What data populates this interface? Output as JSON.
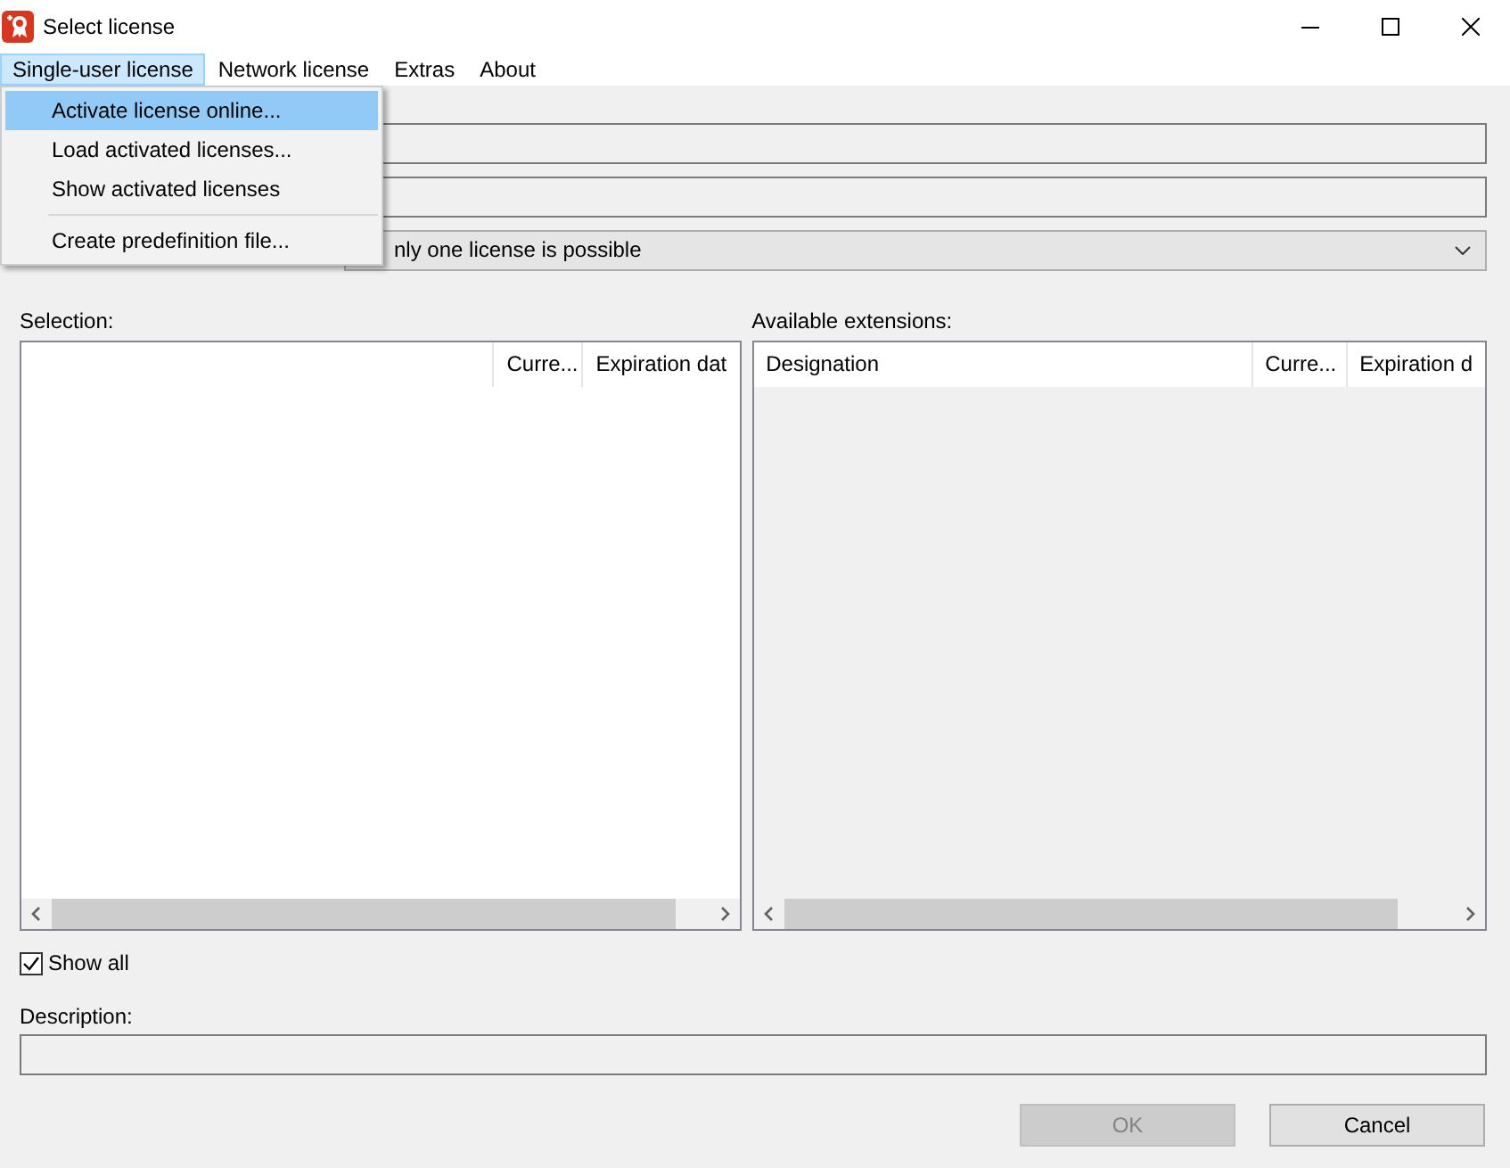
{
  "window": {
    "title": "Select license"
  },
  "menu": [
    {
      "label": "Single-user license",
      "selected": true
    },
    {
      "label": "Network license",
      "selected": false
    },
    {
      "label": "Extras",
      "selected": false
    },
    {
      "label": "About",
      "selected": false
    }
  ],
  "open_menu": {
    "items": [
      {
        "kind": "item",
        "label": "Activate license online...",
        "selected": true
      },
      {
        "kind": "item",
        "label": "Load activated licenses...",
        "selected": false
      },
      {
        "kind": "item",
        "label": "Show activated licenses",
        "selected": false
      },
      {
        "kind": "separator"
      },
      {
        "kind": "item",
        "label": "Create predefinition file...",
        "selected": false
      }
    ]
  },
  "license_combo": {
    "value": "nly one license is possible"
  },
  "selection": {
    "label": "Selection:",
    "columns": [
      {
        "label": "Curre..."
      },
      {
        "label": "Expiration dat"
      }
    ]
  },
  "available_extensions": {
    "label": "Available extensions:",
    "columns": [
      {
        "label": "Designation"
      },
      {
        "label": "Curre..."
      },
      {
        "label": "Expiration d"
      }
    ]
  },
  "show_all": {
    "label": "Show all",
    "checked": true
  },
  "description": {
    "label": "Description:"
  },
  "buttons": [
    {
      "label": "OK",
      "disabled": true
    },
    {
      "label": "Cancel",
      "disabled": false
    }
  ]
}
